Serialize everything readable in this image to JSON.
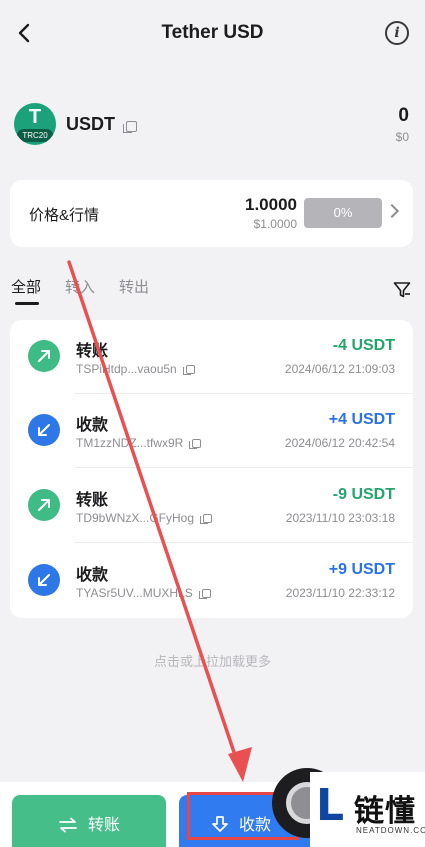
{
  "header": {
    "title": "Tether USD",
    "back_icon": "chevron-left-icon",
    "info_icon": "info-icon",
    "info_glyph": "i"
  },
  "token": {
    "symbol": "USDT",
    "logo_letter": "T",
    "network": "TRC20",
    "balance": "0",
    "balance_usd": "$0"
  },
  "price": {
    "label": "价格&行情",
    "value": "1.0000",
    "value_usd": "$1.0000",
    "change": "0%"
  },
  "tabs": [
    {
      "label": "全部",
      "active": true
    },
    {
      "label": "转入",
      "active": false
    },
    {
      "label": "转出",
      "active": false
    }
  ],
  "transactions": [
    {
      "type": "转账",
      "direction": "out",
      "address": "TSPiHtdp...vaou5n",
      "amount": "-4 USDT",
      "time": "2024/06/12 21:09:03"
    },
    {
      "type": "收款",
      "direction": "in",
      "address": "TM1zzNDZ...tfwx9R",
      "amount": "+4 USDT",
      "time": "2024/06/12 20:42:54"
    },
    {
      "type": "转账",
      "direction": "out",
      "address": "TD9bWNzX...GFyHog",
      "amount": "-9 USDT",
      "time": "2023/11/10 23:03:18"
    },
    {
      "type": "收款",
      "direction": "in",
      "address": "TYASr5UV...MUXHLS",
      "amount": "+9 USDT",
      "time": "2023/11/10 22:33:12"
    }
  ],
  "load_more": "点击或上拉加载更多",
  "actions": {
    "send_label": "转账",
    "receive_label": "收款"
  },
  "watermark": {
    "logo_letter": "L",
    "name": "链懂",
    "url": "NEATDOWN.COM"
  },
  "colors": {
    "send": "#46be8a",
    "receive": "#2f7bef",
    "amount_out": "#25a46c",
    "amount_in": "#2a73e3",
    "highlight": "#e64646"
  }
}
